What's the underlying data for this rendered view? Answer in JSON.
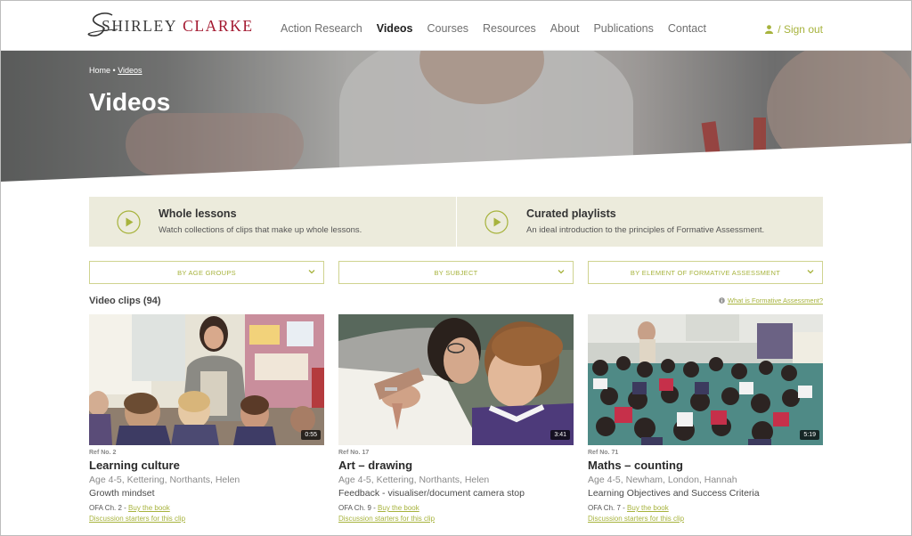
{
  "header": {
    "logo": {
      "first": "SHIRLEY",
      "second": "CLARKE"
    },
    "nav": [
      {
        "label": "Action Research",
        "active": false
      },
      {
        "label": "Videos",
        "active": true
      },
      {
        "label": "Courses",
        "active": false
      },
      {
        "label": "Resources",
        "active": false
      },
      {
        "label": "About",
        "active": false
      },
      {
        "label": "Publications",
        "active": false
      },
      {
        "label": "Contact",
        "active": false
      }
    ],
    "signout": "/ Sign out"
  },
  "hero": {
    "breadcrumb": {
      "home": "Home",
      "separator": "•",
      "current": "Videos"
    },
    "title": "Videos"
  },
  "promos": [
    {
      "title": "Whole lessons",
      "description": "Watch collections of clips that make up whole lessons."
    },
    {
      "title": "Curated playlists",
      "description": "An ideal introduction to the principles of Formative Assessment."
    }
  ],
  "filters": {
    "age": "BY AGE GROUPS",
    "subject": "BY SUBJECT",
    "element": "BY ELEMENT OF FORMATIVE ASSESSMENT"
  },
  "clips_heading": "Video clips (94)",
  "fa_link": "What is Formative Assessment?",
  "cards": [
    {
      "ref": "Ref No. 2",
      "title": "Learning culture",
      "meta": "Age 4-5, Kettering, Northants, Helen",
      "topic": "Growth mindset",
      "ofa": "OFA Ch. 2 -",
      "buy": "Buy the book",
      "discussion": "Discussion starters for this clip",
      "duration": "0:55"
    },
    {
      "ref": "Ref No. 17",
      "title": "Art – drawing",
      "meta": "Age 4-5, Kettering, Northants, Helen",
      "topic": "Feedback - visualiser/document camera stop",
      "ofa": "OFA Ch. 9 -",
      "buy": "Buy the book",
      "discussion": "Discussion starters for this clip",
      "duration": "3:41"
    },
    {
      "ref": "Ref No. 71",
      "title": "Maths – counting",
      "meta": "Age 4-5, Newham, London, Hannah",
      "topic": "Learning Objectives and Success Criteria",
      "ofa": "OFA Ch. 7 -",
      "buy": "Buy the book",
      "discussion": "Discussion starters for this clip",
      "duration": "5:19"
    }
  ],
  "colors": {
    "accent": "#a7b33d",
    "brand_red": "#a3182f",
    "promo_bg": "#ecebdc"
  },
  "icons": [
    "user-icon",
    "play-icon",
    "chevron-down-icon",
    "info-icon"
  ]
}
